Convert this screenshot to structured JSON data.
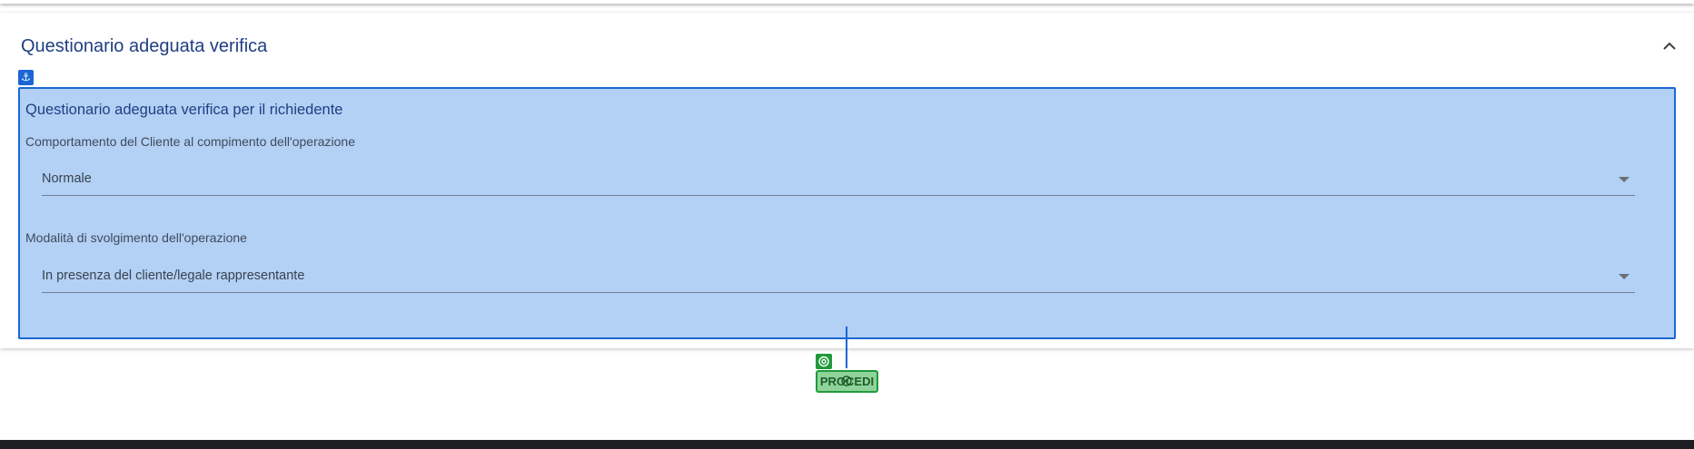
{
  "card": {
    "title": "Questionario adeguata verifica",
    "collapse_icon": "chevron-up-icon"
  },
  "overlay": {
    "badge_icon": "anchor-icon",
    "section_title": "Questionario adeguata verifica per il richiedente",
    "fields": [
      {
        "label": "Comportamento del Cliente al compimento dell'operazione",
        "value": "Normale"
      },
      {
        "label": "Modalità di svolgimento dell'operazione",
        "value": "In presenza del cliente/legale rappresentante"
      }
    ]
  },
  "proceed": {
    "label": "PROCEDI",
    "badge_icon": "target-icon",
    "handle_icon": "move-icon"
  },
  "colors": {
    "overlay_fill": "#b3d1f5",
    "overlay_border": "#1a66d6",
    "proceed_fill": "#8fd39b",
    "proceed_border": "#1f9a3a",
    "title_text": "#1f3f82"
  }
}
